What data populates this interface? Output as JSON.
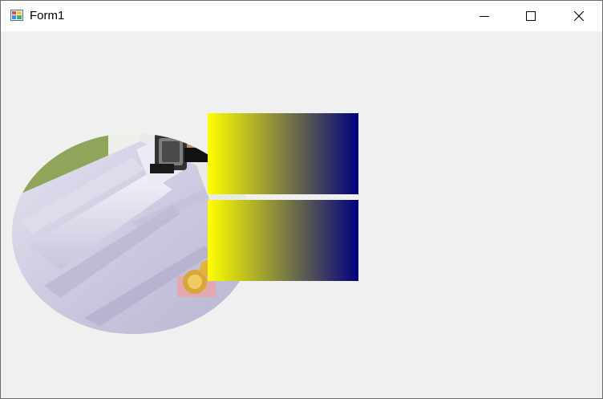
{
  "window": {
    "title": "Form1",
    "app_icon": "winforms-app-icon",
    "controls": {
      "minimize_icon": "minimize-icon",
      "maximize_icon": "maximize-icon",
      "close_icon": "close-icon"
    }
  },
  "client": {
    "background_color": "#f0f0f0",
    "photo": {
      "shape": "ellipse",
      "content": "white-sleeve-with-wristwatch"
    },
    "gradient_panels": [
      {
        "from_color": "#ffff00",
        "to_color": "#000080"
      },
      {
        "from_color": "#ffff00",
        "to_color": "#000080"
      }
    ]
  }
}
